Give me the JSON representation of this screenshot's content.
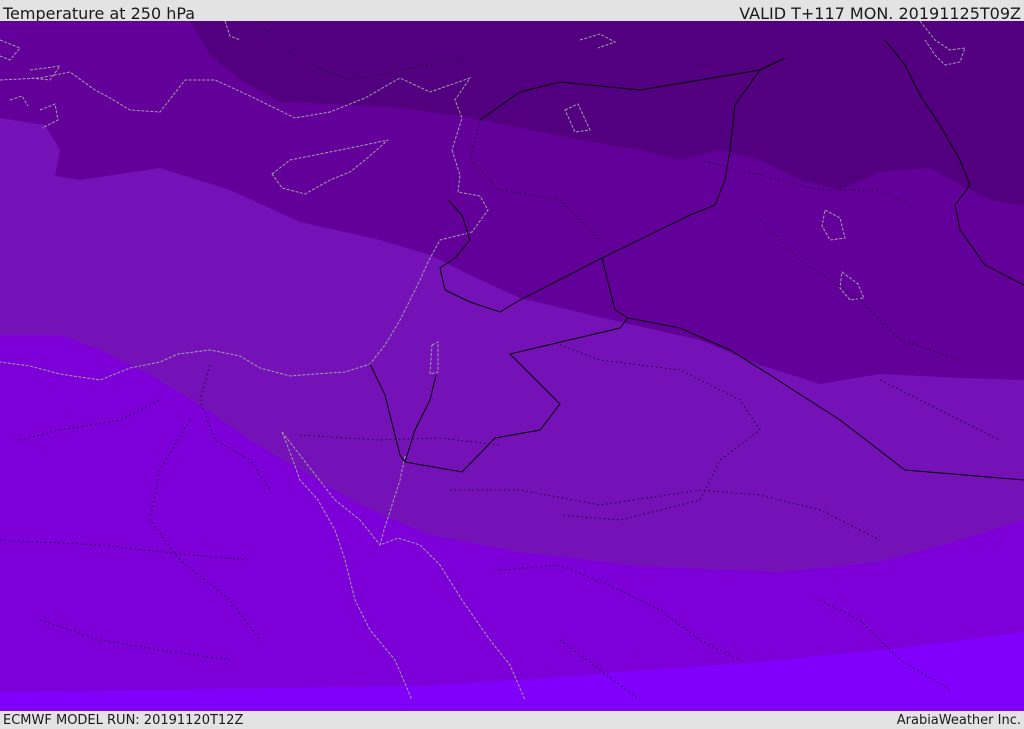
{
  "header": {
    "title": "Temperature at 250 hPa",
    "valid_time": "VALID T+117 MON. 20191125T09Z"
  },
  "footer": {
    "model_run": "ECMWF MODEL RUN: 20191120T12Z",
    "credit": "ArabiaWeather Inc."
  },
  "map": {
    "temperature_band_colors": [
      "#520080",
      "#64009a",
      "#7412b8",
      "#7d00d8",
      "#8000fb"
    ],
    "coastline_color": "#a0a0a8",
    "border_color": "#000000"
  }
}
